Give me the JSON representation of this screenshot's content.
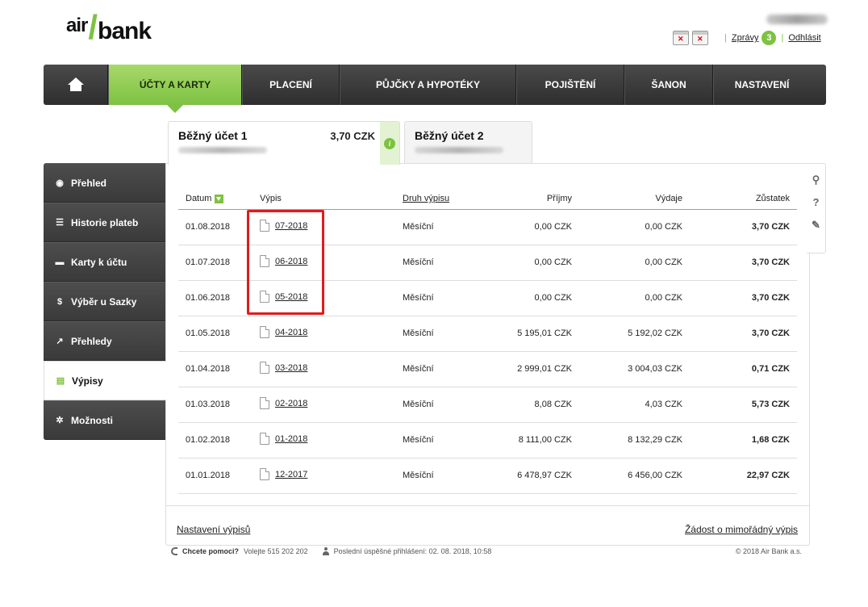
{
  "header": {
    "logo_left": "air",
    "logo_right": "bank",
    "messages_label": "Zprávy",
    "messages_count": "3",
    "logout_label": "Odhlásit"
  },
  "nav": {
    "items": [
      "ÚČTY A KARTY",
      "PLACENÍ",
      "PŮJČKY A HYPOTÉKY",
      "POJIŠTĚNÍ",
      "ŠANON",
      "NASTAVENÍ"
    ]
  },
  "accounts": [
    {
      "name": "Běžný účet 1",
      "balance": "3,70 CZK"
    },
    {
      "name": "Běžný účet 2"
    }
  ],
  "sidebar": {
    "items": [
      "Přehled",
      "Historie plateb",
      "Karty k účtu",
      "Výběr u Sazky",
      "Přehledy",
      "Výpisy",
      "Možnosti"
    ]
  },
  "table": {
    "headers": [
      "Datum",
      "Výpis",
      "Druh výpisu",
      "Příjmy",
      "Výdaje",
      "Zůstatek"
    ],
    "rows": [
      {
        "date": "01.08.2018",
        "statement": "07-2018",
        "type": "Měsíční",
        "income": "0,00 CZK",
        "expense": "0,00 CZK",
        "balance": "3,70 CZK"
      },
      {
        "date": "01.07.2018",
        "statement": "06-2018",
        "type": "Měsíční",
        "income": "0,00 CZK",
        "expense": "0,00 CZK",
        "balance": "3,70 CZK"
      },
      {
        "date": "01.06.2018",
        "statement": "05-2018",
        "type": "Měsíční",
        "income": "0,00 CZK",
        "expense": "0,00 CZK",
        "balance": "3,70 CZK"
      },
      {
        "date": "01.05.2018",
        "statement": "04-2018",
        "type": "Měsíční",
        "income": "5 195,01 CZK",
        "expense": "5 192,02 CZK",
        "balance": "3,70 CZK"
      },
      {
        "date": "01.04.2018",
        "statement": "03-2018",
        "type": "Měsíční",
        "income": "2 999,01 CZK",
        "expense": "3 004,03 CZK",
        "balance": "0,71 CZK"
      },
      {
        "date": "01.03.2018",
        "statement": "02-2018",
        "type": "Měsíční",
        "income": "8,08 CZK",
        "expense": "4,03 CZK",
        "balance": "5,73 CZK"
      },
      {
        "date": "01.02.2018",
        "statement": "01-2018",
        "type": "Měsíční",
        "income": "8 111,00 CZK",
        "expense": "8 132,29 CZK",
        "balance": "1,68 CZK"
      },
      {
        "date": "01.01.2018",
        "statement": "12-2017",
        "type": "Měsíční",
        "income": "6 478,97 CZK",
        "expense": "6 456,00 CZK",
        "balance": "22,97 CZK"
      }
    ]
  },
  "footer": {
    "settings_link": "Nastavení výpisů",
    "request_link": "Žádost o mimořádný výpis",
    "help_bold": "Chcete pomoci?",
    "help_text": "Volejte 515 202 202",
    "last_login": "Poslední úspěšné přihlášení: 02. 08. 2018, 10:58",
    "copyright": "© 2018 Air Bank a.s."
  },
  "colors": {
    "accent": "#7dc242",
    "highlight": "#e01b1b",
    "nav_dark": "#3a3a3a"
  }
}
